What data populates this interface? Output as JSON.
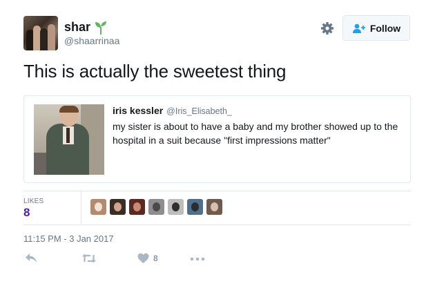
{
  "user": {
    "display_name": "shar",
    "handle": "@shaarrinaa",
    "avatar_icon": "group-photo-avatar",
    "badge_icon": "sprout-icon"
  },
  "header": {
    "settings_icon": "gear-icon",
    "follow_label": "Follow",
    "follow_icon": "add-user-icon"
  },
  "tweet": {
    "text": "This is actually the sweetest thing",
    "timestamp": "11:15 PM - 3 Jan 2017"
  },
  "quoted_tweet": {
    "name": "iris kessler",
    "handle": "@Iris_Elisabeth_",
    "text": "my sister is about to have a baby and my brother showed up to the hospital in a suit because \"first impressions matter\""
  },
  "stats": {
    "likes_label": "LIKES",
    "likes_count": "8",
    "likes_color": "#4a1db4",
    "likers_count": 7
  },
  "actions": {
    "reply_icon": "reply-icon",
    "retweet_icon": "retweet-icon",
    "like_icon": "heart-icon",
    "like_count": "8",
    "more_icon": "more-dots-icon"
  },
  "colors": {
    "text": "#14171a",
    "muted": "#657786",
    "border": "#e1e8ed",
    "icon": "#aab8c2",
    "sprout": "#5cb85c"
  }
}
